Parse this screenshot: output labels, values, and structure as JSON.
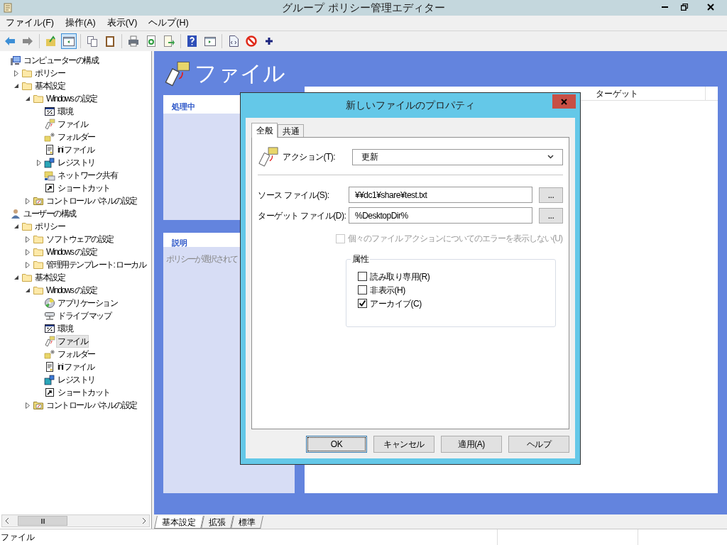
{
  "window": {
    "title": "グループ ポリシー管理エディター"
  },
  "menu": [
    "ファイル(F)",
    "操作(A)",
    "表示(V)",
    "ヘルプ(H)"
  ],
  "toolbar": [
    {
      "buttons": [
        {
          "pressed": false
        },
        {
          "pressed": false
        }
      ]
    },
    {
      "buttons": [
        {
          "pressed": false
        },
        {
          "pressed": true
        }
      ]
    },
    {
      "buttons": [
        {
          "pressed": false
        },
        {
          "pressed": false
        }
      ]
    },
    {
      "buttons": [
        {
          "pressed": false
        },
        {
          "pressed": false
        },
        {
          "pressed": false
        }
      ]
    },
    {
      "buttons": [
        {
          "pressed": false
        },
        {
          "pressed": false
        }
      ]
    },
    {
      "buttons": [
        {
          "pressed": false
        },
        {
          "pressed": false
        },
        {
          "pressed": false
        }
      ]
    }
  ],
  "tree": [
    {
      "label": "コンピューターの構成",
      "kind": "computer",
      "selected": false,
      "children": [
        {
          "label": "ポリシー",
          "kind": "folder",
          "expanded": false,
          "selected": false
        },
        {
          "label": "基本設定",
          "kind": "folder",
          "expanded": true,
          "selected": false,
          "children": [
            {
              "label": "Windows の設定",
              "kind": "folder",
              "expanded": true,
              "selected": false,
              "children": [
                {
                  "label": "環境",
                  "kind": "env",
                  "selected": false
                },
                {
                  "label": "ファイル",
                  "kind": "file",
                  "selected": false
                },
                {
                  "label": "フォルダー",
                  "kind": "newfolder",
                  "selected": false
                },
                {
                  "label": "ini ファイル",
                  "kind": "ini",
                  "selected": false
                },
                {
                  "label": "レジストリ",
                  "kind": "registry",
                  "expanded": false,
                  "selected": false
                },
                {
                  "label": "ネットワーク共有",
                  "kind": "share",
                  "selected": false
                },
                {
                  "label": "ショートカット",
                  "kind": "shortcut",
                  "selected": false
                }
              ]
            },
            {
              "label": "コントロール パネルの設定",
              "kind": "control",
              "expanded": false,
              "selected": false
            }
          ]
        }
      ]
    },
    {
      "label": "ユーザーの構成",
      "kind": "user",
      "selected": false,
      "children": [
        {
          "label": "ポリシー",
          "kind": "folder",
          "expanded": true,
          "selected": false,
          "children": [
            {
              "label": "ソフトウェアの設定",
              "kind": "folder",
              "expanded": false,
              "selected": false
            },
            {
              "label": "Windows の設定",
              "kind": "folder",
              "expanded": false,
              "selected": false
            },
            {
              "label": "管理用テンプレート: ローカル",
              "kind": "folder",
              "expanded": false,
              "selected": false
            }
          ]
        },
        {
          "label": "基本設定",
          "kind": "folder",
          "expanded": true,
          "selected": false,
          "children": [
            {
              "label": "Windows の設定",
              "kind": "folder",
              "expanded": true,
              "selected": false,
              "children": [
                {
                  "label": "アプリケーション",
                  "kind": "app",
                  "selected": false
                },
                {
                  "label": "ドライブ マップ",
                  "kind": "drive",
                  "selected": false
                },
                {
                  "label": "環境",
                  "kind": "env",
                  "selected": false
                },
                {
                  "label": "ファイル",
                  "kind": "file",
                  "selected": true
                },
                {
                  "label": "フォルダー",
                  "kind": "newfolder",
                  "selected": false
                },
                {
                  "label": "ini ファイル",
                  "kind": "ini",
                  "selected": false
                },
                {
                  "label": "レジストリ",
                  "kind": "registry",
                  "selected": false
                },
                {
                  "label": "ショートカット",
                  "kind": "shortcut",
                  "selected": false
                }
              ]
            },
            {
              "label": "コントロール パネルの設定",
              "kind": "control",
              "expanded": false,
              "selected": false
            }
          ]
        }
      ]
    }
  ],
  "content": {
    "heading": "ファイル",
    "processing": {
      "title": "処理中"
    },
    "description": {
      "title": "説明",
      "text": "ポリシーが選択されて"
    },
    "columns": [
      "ターゲット"
    ]
  },
  "view_tabs": [
    {
      "label": "基本設定",
      "selected": true
    },
    {
      "label": "拡張",
      "selected": false
    },
    {
      "label": "標準",
      "selected": false
    }
  ],
  "status_bar": {
    "text": "ファイル"
  },
  "dialog": {
    "title": "新しいファイルのプロパティ",
    "tabs": [
      {
        "label": "全般",
        "selected": true
      },
      {
        "label": "共通",
        "selected": false
      }
    ],
    "action": {
      "label": "アクション(T):",
      "value": "更新"
    },
    "fields": [
      {
        "label": "ソース ファイル(S):",
        "value": "¥¥dc1¥share¥test.txt",
        "browse": "..."
      },
      {
        "label": "ターゲット ファイル(D):",
        "value": "%DesktopDir%",
        "browse": "..."
      }
    ],
    "suppress": {
      "label": "個々のファイル アクションについてのエラーを表示しない(U)",
      "checked": false,
      "disabled": true
    },
    "attributes": {
      "title": "属性",
      "items": [
        {
          "label": "読み取り専用(R)",
          "checked": false
        },
        {
          "label": "非表示(H)",
          "checked": false
        },
        {
          "label": "アーカイブ(C)",
          "checked": true
        }
      ]
    },
    "buttons": [
      {
        "label": "OK",
        "default": true
      },
      {
        "label": "キャンセル",
        "default": false
      },
      {
        "label": "適用(A)",
        "default": false
      },
      {
        "label": "ヘルプ",
        "default": false
      }
    ]
  }
}
